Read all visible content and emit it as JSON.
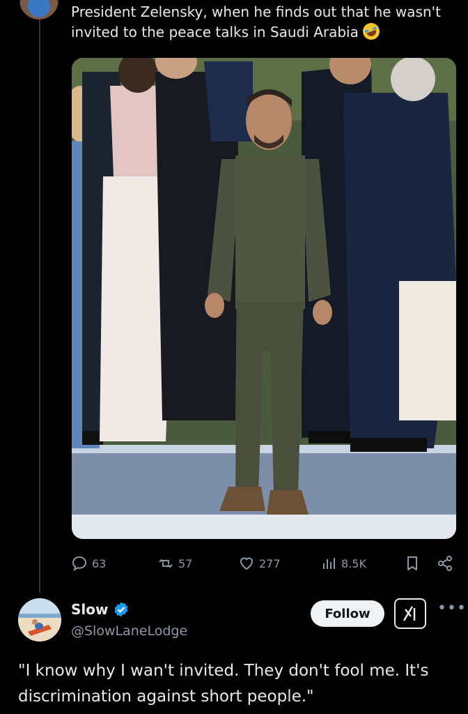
{
  "post": {
    "text": "President Zelensky, when he finds out that he wasn't invited to the peace talks in Saudi Arabia",
    "emoji": "rolling-on-the-floor-laughing-emoji",
    "media_alt": "Photo of Zelensky in olive military-style clothes standing on a stage among people in formal wear"
  },
  "actions": {
    "replies": "63",
    "reposts": "57",
    "likes": "277",
    "views": "8.5K"
  },
  "reply": {
    "name": "Slow",
    "handle": "@SlowLaneLodge",
    "follow_label": "Follow",
    "text": "\"I know why I wan't invited. They don't fool me. It's discrimination against short people.\""
  },
  "colors": {
    "background": "#000000",
    "text": "#e7e9ea",
    "muted": "#8b98a5",
    "verified": "#1d9bf0"
  }
}
